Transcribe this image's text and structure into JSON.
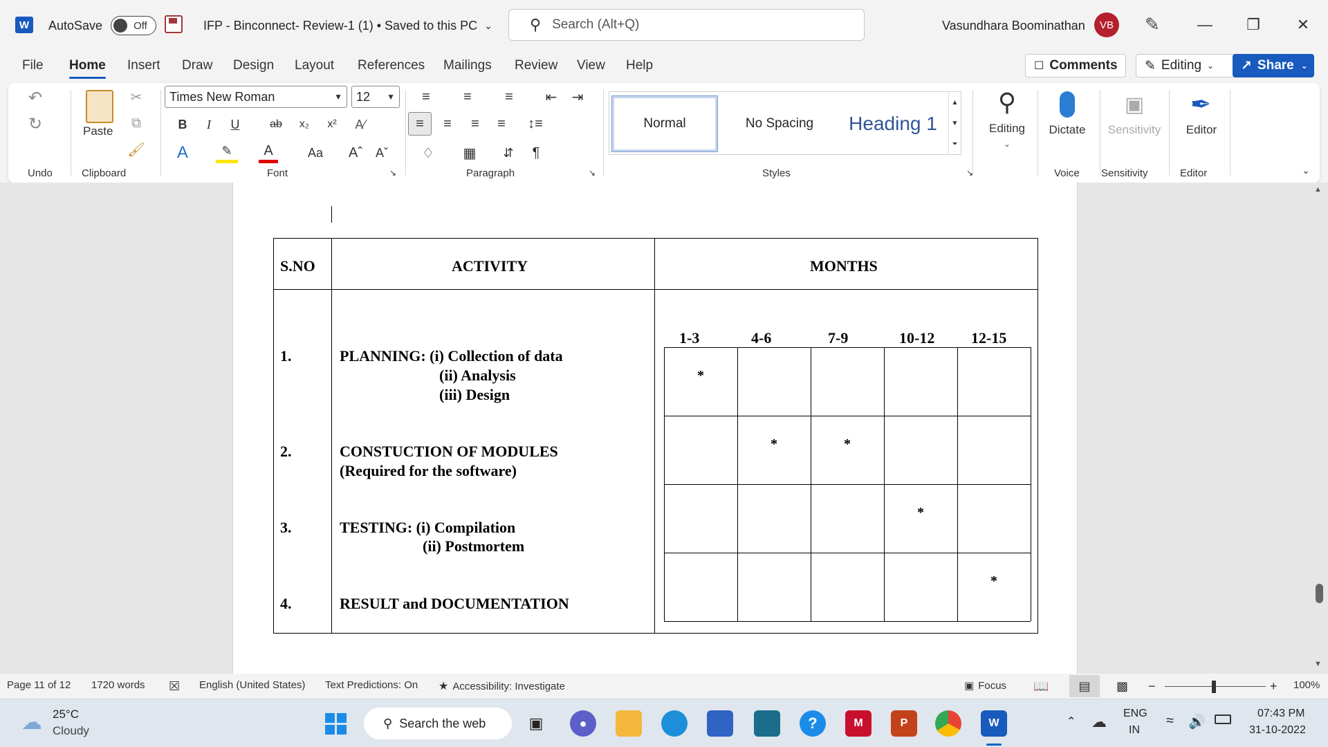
{
  "titlebar": {
    "autosave_label": "AutoSave",
    "autosave_state": "Off",
    "doc_title": "IFP - Binconnect- Review-1 (1) • Saved to this PC",
    "search_placeholder": "Search (Alt+Q)",
    "user_name": "Vasundhara Boominathan",
    "user_initials": "VB"
  },
  "menu": {
    "tabs": [
      "File",
      "Home",
      "Insert",
      "Draw",
      "Design",
      "Layout",
      "References",
      "Mailings",
      "Review",
      "View",
      "Help"
    ],
    "active_tab": "Home",
    "comments_label": "Comments",
    "editing_label": "Editing",
    "share_label": "Share"
  },
  "ribbon": {
    "groups": {
      "undo": "Undo",
      "clipboard": "Clipboard",
      "font": "Font",
      "paragraph": "Paragraph",
      "styles": "Styles",
      "voice": "Voice",
      "sensitivity": "Sensitivity",
      "editor": "Editor"
    },
    "paste_label": "Paste",
    "font_name": "Times New Roman",
    "font_size": "12",
    "case_label": "Aa",
    "styles": [
      "Normal",
      "No Spacing",
      "Heading 1"
    ],
    "editing_label": "Editing",
    "dictate_label": "Dictate",
    "sensitivity_label": "Sensitivity",
    "editor_label": "Editor"
  },
  "document": {
    "headers": {
      "sno": "S.NO",
      "activity": "ACTIVITY",
      "months": "MONTHS"
    },
    "month_ranges": [
      "1-3",
      "4-6",
      "7-9",
      "10-12",
      "12-15"
    ],
    "rows": [
      {
        "sno": "1.",
        "lines": [
          "PLANNING: (i) Collection of data",
          "(ii) Analysis",
          "(iii) Design"
        ]
      },
      {
        "sno": "2.",
        "lines": [
          "CONSTUCTION OF MODULES",
          "(Required for the software)"
        ]
      },
      {
        "sno": "3.",
        "lines": [
          "TESTING: (i) Compilation",
          "(ii) Postmortem"
        ]
      },
      {
        "sno": "4.",
        "lines": [
          "RESULT and DOCUMENTATION"
        ]
      }
    ],
    "schedule_marks": [
      [
        1,
        0,
        0,
        0,
        0
      ],
      [
        0,
        1,
        1,
        0,
        0
      ],
      [
        0,
        0,
        0,
        1,
        0
      ],
      [
        0,
        0,
        0,
        0,
        1
      ]
    ],
    "mark_symbol": "*"
  },
  "statusbar": {
    "page": "Page 11 of 12",
    "words": "1720 words",
    "language": "English (United States)",
    "text_predictions": "Text Predictions: On",
    "accessibility": "Accessibility: Investigate",
    "focus": "Focus",
    "zoom": "100%"
  },
  "taskbar": {
    "weather_temp": "25°C",
    "weather_desc": "Cloudy",
    "search_label": "Search the web",
    "lang_line1": "ENG",
    "lang_line2": "IN",
    "time": "07:43 PM",
    "date": "31-10-2022"
  },
  "colors": {
    "accent": "#185abd",
    "avatar": "#b4202d"
  }
}
